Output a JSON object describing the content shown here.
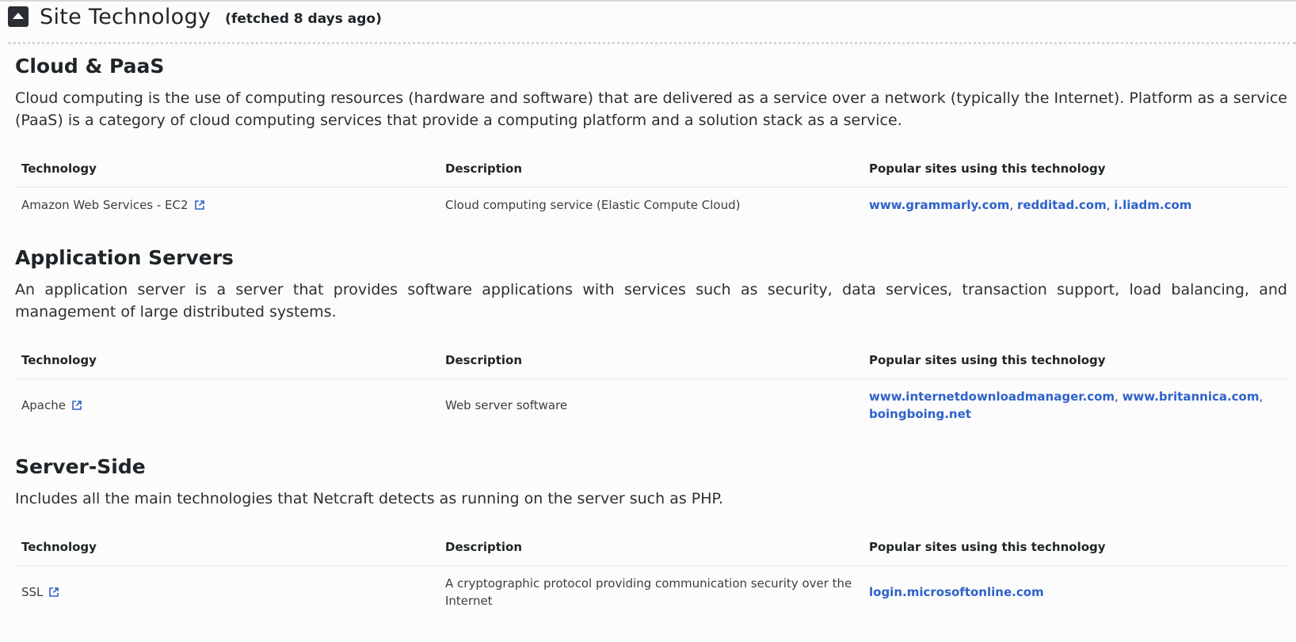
{
  "header": {
    "title": "Site Technology",
    "fetched": "(fetched 8 days ago)"
  },
  "columns": {
    "technology": "Technology",
    "description": "Description",
    "sites": "Popular sites using this technology"
  },
  "categories": [
    {
      "title": "Cloud & PaaS",
      "description": "Cloud computing is the use of computing resources (hardware and software) that are delivered as a service over a network (typically the Internet). Platform as a service (PaaS) is a category of cloud computing services that provide a computing platform and a solution stack as a service.",
      "rows": [
        {
          "technology": "Amazon Web Services - EC2",
          "description": "Cloud computing service (Elastic Compute Cloud)",
          "sites": [
            "www.grammarly.com",
            "redditad.com",
            "i.liadm.com"
          ]
        }
      ]
    },
    {
      "title": "Application Servers",
      "description": "An application server is a server that provides software applications with services such as security, data services, transaction support, load balancing, and management of large distributed systems.",
      "rows": [
        {
          "technology": "Apache",
          "description": "Web server software",
          "sites": [
            "www.internetdownloadmanager.com",
            "www.britannica.com",
            "boingboing.net"
          ]
        }
      ]
    },
    {
      "title": "Server-Side",
      "description": "Includes all the main technologies that Netcraft detects as running on the server such as PHP.",
      "rows": [
        {
          "technology": "SSL",
          "description": "A cryptographic protocol providing communication security over the Internet",
          "sites": [
            "login.microsoftonline.com"
          ]
        }
      ]
    }
  ]
}
